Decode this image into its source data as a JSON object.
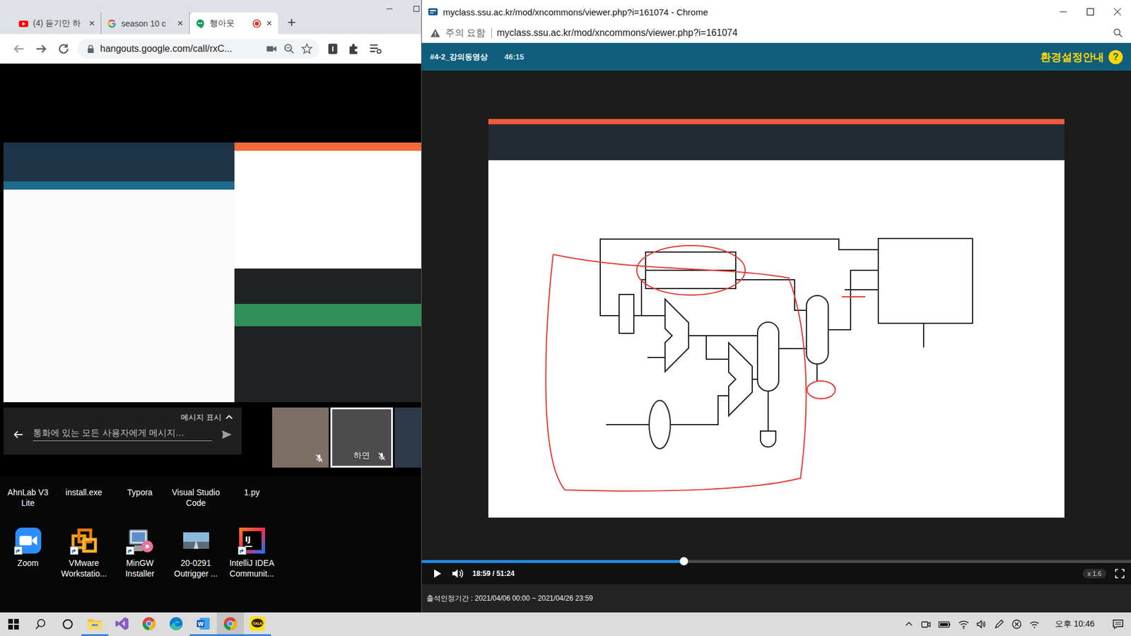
{
  "left_window": {
    "tabs": [
      {
        "label": "(4) 듣기만 하",
        "kind": "youtube",
        "selected": false,
        "recording": false
      },
      {
        "label": "season 10 c",
        "kind": "google",
        "selected": false,
        "recording": false
      },
      {
        "label": "행아웃",
        "kind": "hangouts",
        "selected": true,
        "recording": true
      }
    ],
    "new_tab": "+",
    "close_glyph": "×",
    "url": "hangouts.google.com/call/rxC...",
    "call": {
      "messages_toggle": "메시지 표시",
      "message_placeholder": "통화에 있는 모든 사용자에게 메시지…",
      "participants": [
        {
          "muted": true,
          "selected": false
        },
        {
          "label": "하연",
          "muted": true,
          "selected": true
        },
        {
          "muted": false,
          "selected": false
        }
      ]
    }
  },
  "desktop_icons": [
    {
      "label": "AhnLab V3 Lite",
      "kind": "covered",
      "shortcut": false
    },
    {
      "label": "install.exe",
      "kind": "covered",
      "shortcut": false
    },
    {
      "label": "Typora",
      "kind": "covered",
      "shortcut": false
    },
    {
      "label": "Visual Studio Code",
      "kind": "covered",
      "shortcut": false
    },
    {
      "label": "1.py",
      "kind": "covered",
      "shortcut": false
    },
    {
      "label": "Zoom",
      "kind": "zoom",
      "shortcut": true
    },
    {
      "label": "VMware Workstatio...",
      "kind": "vmware",
      "shortcut": true
    },
    {
      "label": "MinGW Installer",
      "kind": "mingw",
      "shortcut": true
    },
    {
      "label": "20-0291 Outrigger ...",
      "kind": "photo",
      "shortcut": false
    },
    {
      "label": "IntelliJ IDEA Communit...",
      "kind": "intellij",
      "shortcut": true,
      "logo_text": "IJ"
    }
  ],
  "right_window": {
    "title": "myclass.ssu.ac.kr/mod/xncommons/viewer.php?i=161074 - Chrome",
    "security": "주의 요함",
    "url": "myclass.ssu.ac.kr/mod/xncommons/viewer.php?i=161074",
    "header": {
      "lecture": "#4-2_강의동영상",
      "duration": "46:15",
      "help": "환경설정안내",
      "help_badge": "?"
    },
    "player": {
      "playing": false,
      "level": 0.37,
      "time": "18:59 / 51:24",
      "speed": "x 1.6"
    },
    "attendance": "출석인정기간 : 2021/04/06 00:00 ~ 2021/04/26 23:59"
  },
  "taskbar": {
    "apps": [
      {
        "kind": "explorer",
        "running": true,
        "selected": false
      },
      {
        "kind": "visual-studio",
        "running": false,
        "selected": false
      },
      {
        "kind": "chrome",
        "running": false,
        "selected": false
      },
      {
        "kind": "edge",
        "running": false,
        "selected": false
      },
      {
        "kind": "word",
        "running": true,
        "selected": false,
        "logo_text": "W"
      },
      {
        "kind": "chrome",
        "running": true,
        "selected": true
      },
      {
        "kind": "kakaotalk",
        "running": true,
        "selected": false,
        "logo_text": "TALK"
      }
    ],
    "clock": "오후 10:46"
  }
}
